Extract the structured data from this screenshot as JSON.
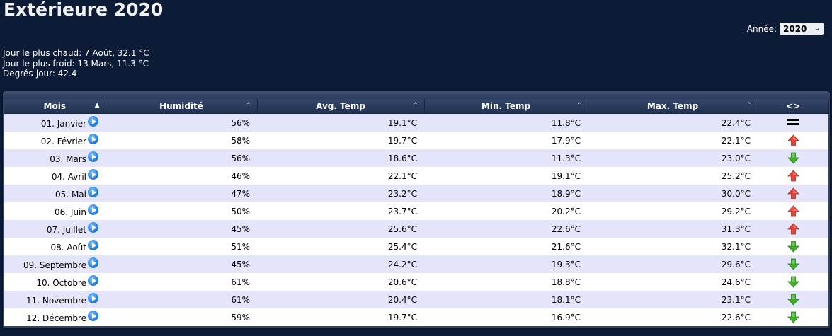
{
  "page": {
    "title": "Extérieure 2020"
  },
  "year_selector": {
    "label": "Année:",
    "selected": "2020"
  },
  "stats": {
    "hottest": "Jour le plus chaud: 7 Août, 32.1 °C",
    "coldest": "Jour le plus froid: 13 Mars, 11.3 °C",
    "degree_days": "Degrés-jour: 42.4"
  },
  "table": {
    "headers": {
      "month": "Mois",
      "humidity": "Humidité",
      "avg": "Avg. Temp",
      "min": "Min. Temp",
      "max": "Max. Temp",
      "trend": "<>"
    },
    "rows": [
      {
        "month": "01. Janvier",
        "humidity": "56%",
        "avg": "19.1°C",
        "min": "11.8°C",
        "max": "22.4°C",
        "trend": "equal"
      },
      {
        "month": "02. Février",
        "humidity": "58%",
        "avg": "19.7°C",
        "min": "17.9°C",
        "max": "22.1°C",
        "trend": "up"
      },
      {
        "month": "03. Mars",
        "humidity": "56%",
        "avg": "18.6°C",
        "min": "11.3°C",
        "max": "23.0°C",
        "trend": "down"
      },
      {
        "month": "04. Avril",
        "humidity": "46%",
        "avg": "22.1°C",
        "min": "19.1°C",
        "max": "25.2°C",
        "trend": "up"
      },
      {
        "month": "05. Mai",
        "humidity": "47%",
        "avg": "23.2°C",
        "min": "18.9°C",
        "max": "30.0°C",
        "trend": "up"
      },
      {
        "month": "06. Juin",
        "humidity": "50%",
        "avg": "23.7°C",
        "min": "20.2°C",
        "max": "29.2°C",
        "trend": "up"
      },
      {
        "month": "07. Juillet",
        "humidity": "45%",
        "avg": "25.6°C",
        "min": "22.6°C",
        "max": "31.3°C",
        "trend": "up"
      },
      {
        "month": "08. Août",
        "humidity": "51%",
        "avg": "25.4°C",
        "min": "21.6°C",
        "max": "32.1°C",
        "trend": "down"
      },
      {
        "month": "09. Septembre",
        "humidity": "45%",
        "avg": "24.2°C",
        "min": "19.3°C",
        "max": "29.6°C",
        "trend": "down"
      },
      {
        "month": "10. Octobre",
        "humidity": "61%",
        "avg": "20.6°C",
        "min": "18.8°C",
        "max": "24.6°C",
        "trend": "down"
      },
      {
        "month": "11. Novembre",
        "humidity": "61%",
        "avg": "20.4°C",
        "min": "18.1°C",
        "max": "23.1°C",
        "trend": "down"
      },
      {
        "month": "12. Décembre",
        "humidity": "59%",
        "avg": "19.7°C",
        "min": "16.9°C",
        "max": "22.6°C",
        "trend": "down"
      }
    ]
  },
  "colors": {
    "background": "#0c1b36",
    "row_odd": "#e4e4fb",
    "row_even": "#ffffff",
    "trend_up": "#e8443a",
    "trend_down": "#3fae2a"
  },
  "icons": {
    "month_link": "play-circle-icon",
    "trend_up": "arrow-up-icon",
    "trend_down": "arrow-down-icon",
    "trend_equal": "equal-icon",
    "sort": "sort-triangle-icon",
    "dropdown": "chevron-down-icon"
  }
}
